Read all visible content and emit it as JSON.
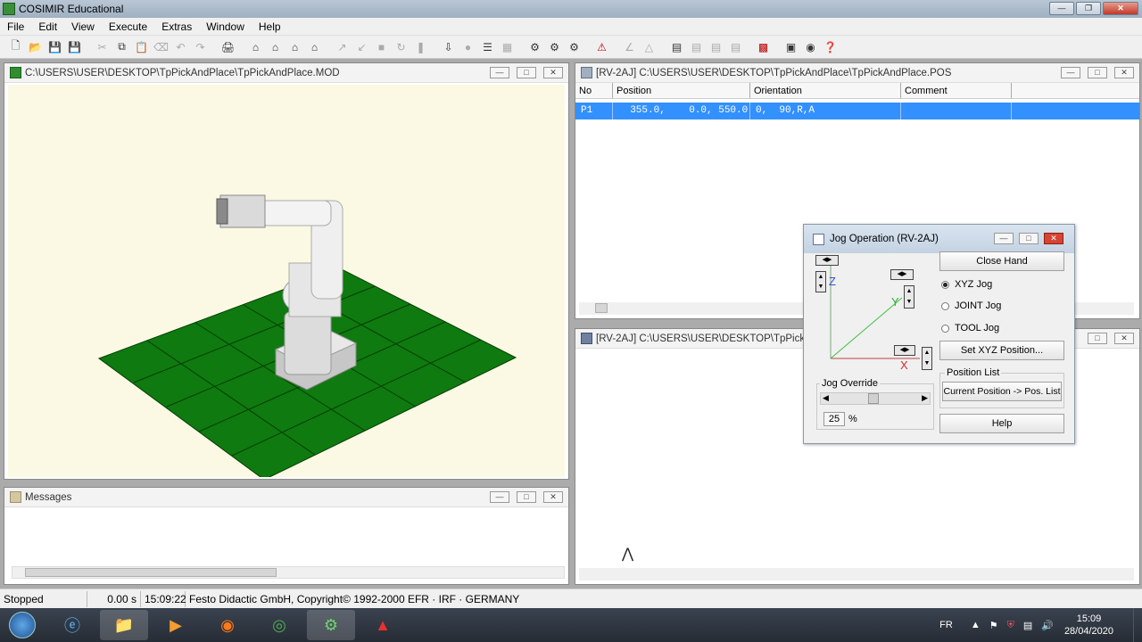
{
  "app": {
    "title": "COSIMIR Educational"
  },
  "menu": [
    "File",
    "Edit",
    "View",
    "Execute",
    "Extras",
    "Window",
    "Help"
  ],
  "model_window": {
    "title": "C:\\USERS\\USER\\DESKTOP\\TpPickAndPlace\\TpPickAndPlace.MOD"
  },
  "pos_window": {
    "title": "[RV-2AJ] C:\\USERS\\USER\\DESKTOP\\TpPickAndPlace\\TpPickAndPlace.POS",
    "columns": [
      "No",
      "Position",
      "Orientation",
      "Comment"
    ],
    "rows": [
      {
        "no": "P1",
        "position": "  355.0,    0.0, 550.0",
        "orientation": "0,  90,R,A",
        "comment": ""
      }
    ]
  },
  "mrl_window": {
    "title": "[RV-2AJ] C:\\USERS\\USER\\DESKTOP\\TpPickAnd"
  },
  "messages_window": {
    "title": "Messages"
  },
  "jog": {
    "title": "Jog Operation (RV-2AJ)",
    "close_hand": "Close Hand",
    "modes": [
      "XYZ Jog",
      "JOINT Jog",
      "TOOL Jog"
    ],
    "selected_mode": "XYZ Jog",
    "set_position": "Set XYZ Position...",
    "position_list_label": "Position List",
    "to_pos_list": "Current Position -> Pos. List",
    "help": "Help",
    "override_label": "Jog Override",
    "override_value": "25",
    "override_unit": "%",
    "axis_z": "Z",
    "axis_y": "Y",
    "axis_x": "X"
  },
  "status": {
    "state": "Stopped",
    "time": "0.00 s",
    "clock": "15:09:22",
    "copyright": "Festo Didactic GmbH, Copyright© 1992-2000  EFR · IRF · GERMANY"
  },
  "taskbar": {
    "lang": "FR",
    "time": "15:09",
    "date": "28/04/2020"
  },
  "colors": {
    "floor": "#0f7a0f",
    "selection": "#3390ff",
    "viewport_bg": "#fbf9e4"
  }
}
